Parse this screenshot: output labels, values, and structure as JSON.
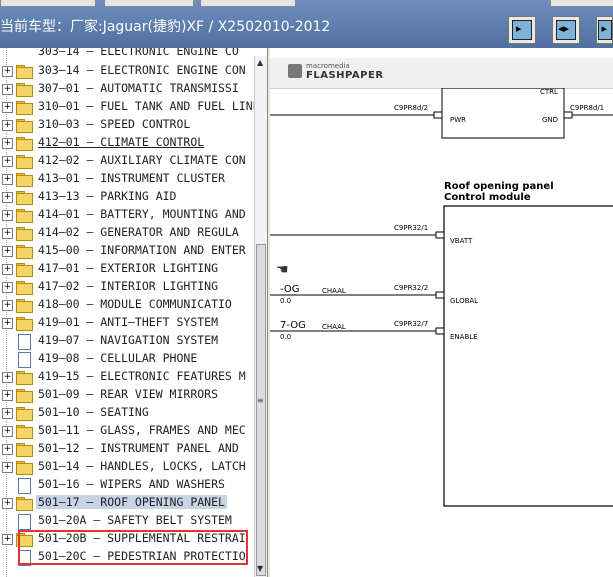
{
  "header": {
    "vehicle_label": "当前车型：厂家:Jaguar(捷豹)XF / X2502010-2012",
    "buttons": [
      {
        "name": "single-page-button",
        "glyph": "▸"
      },
      {
        "name": "two-page-button",
        "glyph": "◂▸"
      },
      {
        "name": "continuous-button",
        "glyph": "▸"
      }
    ]
  },
  "tree": {
    "items": [
      {
        "label": "303—14 — ELECTRONIC ENGINE CON",
        "type": "folder",
        "state": "normal"
      },
      {
        "label": "307—01 — AUTOMATIC TRANSMISSI",
        "type": "folder",
        "state": "normal"
      },
      {
        "label": "310—01 — FUEL TANK AND FUEL LINE",
        "type": "folder",
        "state": "normal"
      },
      {
        "label": "310—03 — SPEED CONTROL",
        "type": "folder",
        "state": "normal"
      },
      {
        "label": "412—01 — CLIMATE CONTROL",
        "type": "folder",
        "state": "hover"
      },
      {
        "label": "412—02 — AUXILIARY CLIMATE CON",
        "type": "folder",
        "state": "normal"
      },
      {
        "label": "413—01 — INSTRUMENT CLUSTER",
        "type": "folder",
        "state": "normal"
      },
      {
        "label": "413—13 — PARKING AID",
        "type": "folder",
        "state": "normal"
      },
      {
        "label": "414—01 — BATTERY, MOUNTING AND",
        "type": "folder",
        "state": "normal"
      },
      {
        "label": "414—02 — GENERATOR AND REGULA",
        "type": "folder",
        "state": "normal"
      },
      {
        "label": "415—00 — INFORMATION AND ENTER",
        "type": "folder",
        "state": "normal"
      },
      {
        "label": "417—01 — EXTERIOR LIGHTING",
        "type": "folder",
        "state": "normal"
      },
      {
        "label": "417—02 — INTERIOR LIGHTING",
        "type": "folder",
        "state": "normal"
      },
      {
        "label": "418—00 — MODULE COMMUNICATIO",
        "type": "folder",
        "state": "normal"
      },
      {
        "label": "419—01 — ANTI—THEFT SYSTEM",
        "type": "folder",
        "state": "normal"
      },
      {
        "label": "419—07 — NAVIGATION SYSTEM",
        "type": "doc",
        "state": "normal"
      },
      {
        "label": "419—08 — CELLULAR PHONE",
        "type": "doc",
        "state": "normal"
      },
      {
        "label": "419—15 — ELECTRONIC FEATURES M",
        "type": "folder",
        "state": "normal"
      },
      {
        "label": "501—09 — REAR VIEW MIRRORS",
        "type": "folder",
        "state": "normal"
      },
      {
        "label": "501—10 — SEATING",
        "type": "folder",
        "state": "normal"
      },
      {
        "label": "501—11 — GLASS, FRAMES AND MEC",
        "type": "folder",
        "state": "normal"
      },
      {
        "label": "501—12 — INSTRUMENT PANEL AND",
        "type": "folder",
        "state": "normal"
      },
      {
        "label": "501—14 — HANDLES, LOCKS, LATCH",
        "type": "folder",
        "state": "normal"
      },
      {
        "label": "501—16 — WIPERS AND WASHERS",
        "type": "doc",
        "state": "normal"
      },
      {
        "label": "501—17 — ROOF OPENING PANEL",
        "type": "folder",
        "state": "selected"
      },
      {
        "label": "501—20A — SAFETY BELT SYSTEM",
        "type": "doc",
        "state": "normal"
      },
      {
        "label": "501—20B — SUPPLEMENTAL RESTRAI",
        "type": "folder",
        "state": "normal"
      },
      {
        "label": "501—20C — PEDESTRIAN PROTECTIO",
        "type": "doc",
        "state": "normal"
      }
    ],
    "partial_top_label": "303—14 — ELECTRONIC ENGINE CO"
  },
  "viewer": {
    "brand_small": "macromedia",
    "brand_name": "FLASHPAPER",
    "diagram": {
      "top_box": {
        "ctrl": "CTRL",
        "pwr": "PWR",
        "gnd": "GND",
        "left_connector": "C9PR8d/2",
        "right_connector": "C9PR8d/1"
      },
      "module_title_line1": "Roof opening panel",
      "module_title_line2": "Control module",
      "pins": [
        {
          "connector": "C9PR32/1",
          "pin": "VBATT",
          "wire_left": "",
          "wire_color": ""
        },
        {
          "connector": "C9PR32/2",
          "pin": "GLOBAL",
          "wire_left": "-OG",
          "wire_color": "CHAAL",
          "sub": "0.0"
        },
        {
          "connector": "C9PR32/7",
          "pin": "ENABLE",
          "wire_left": "7-OG",
          "wire_color": "CHAAL",
          "sub": "0.0"
        }
      ]
    }
  },
  "colors": {
    "selected_highlight": "#c9d3e6",
    "red_annotation": "#e53333",
    "folder_yellow": "#f3d565"
  }
}
